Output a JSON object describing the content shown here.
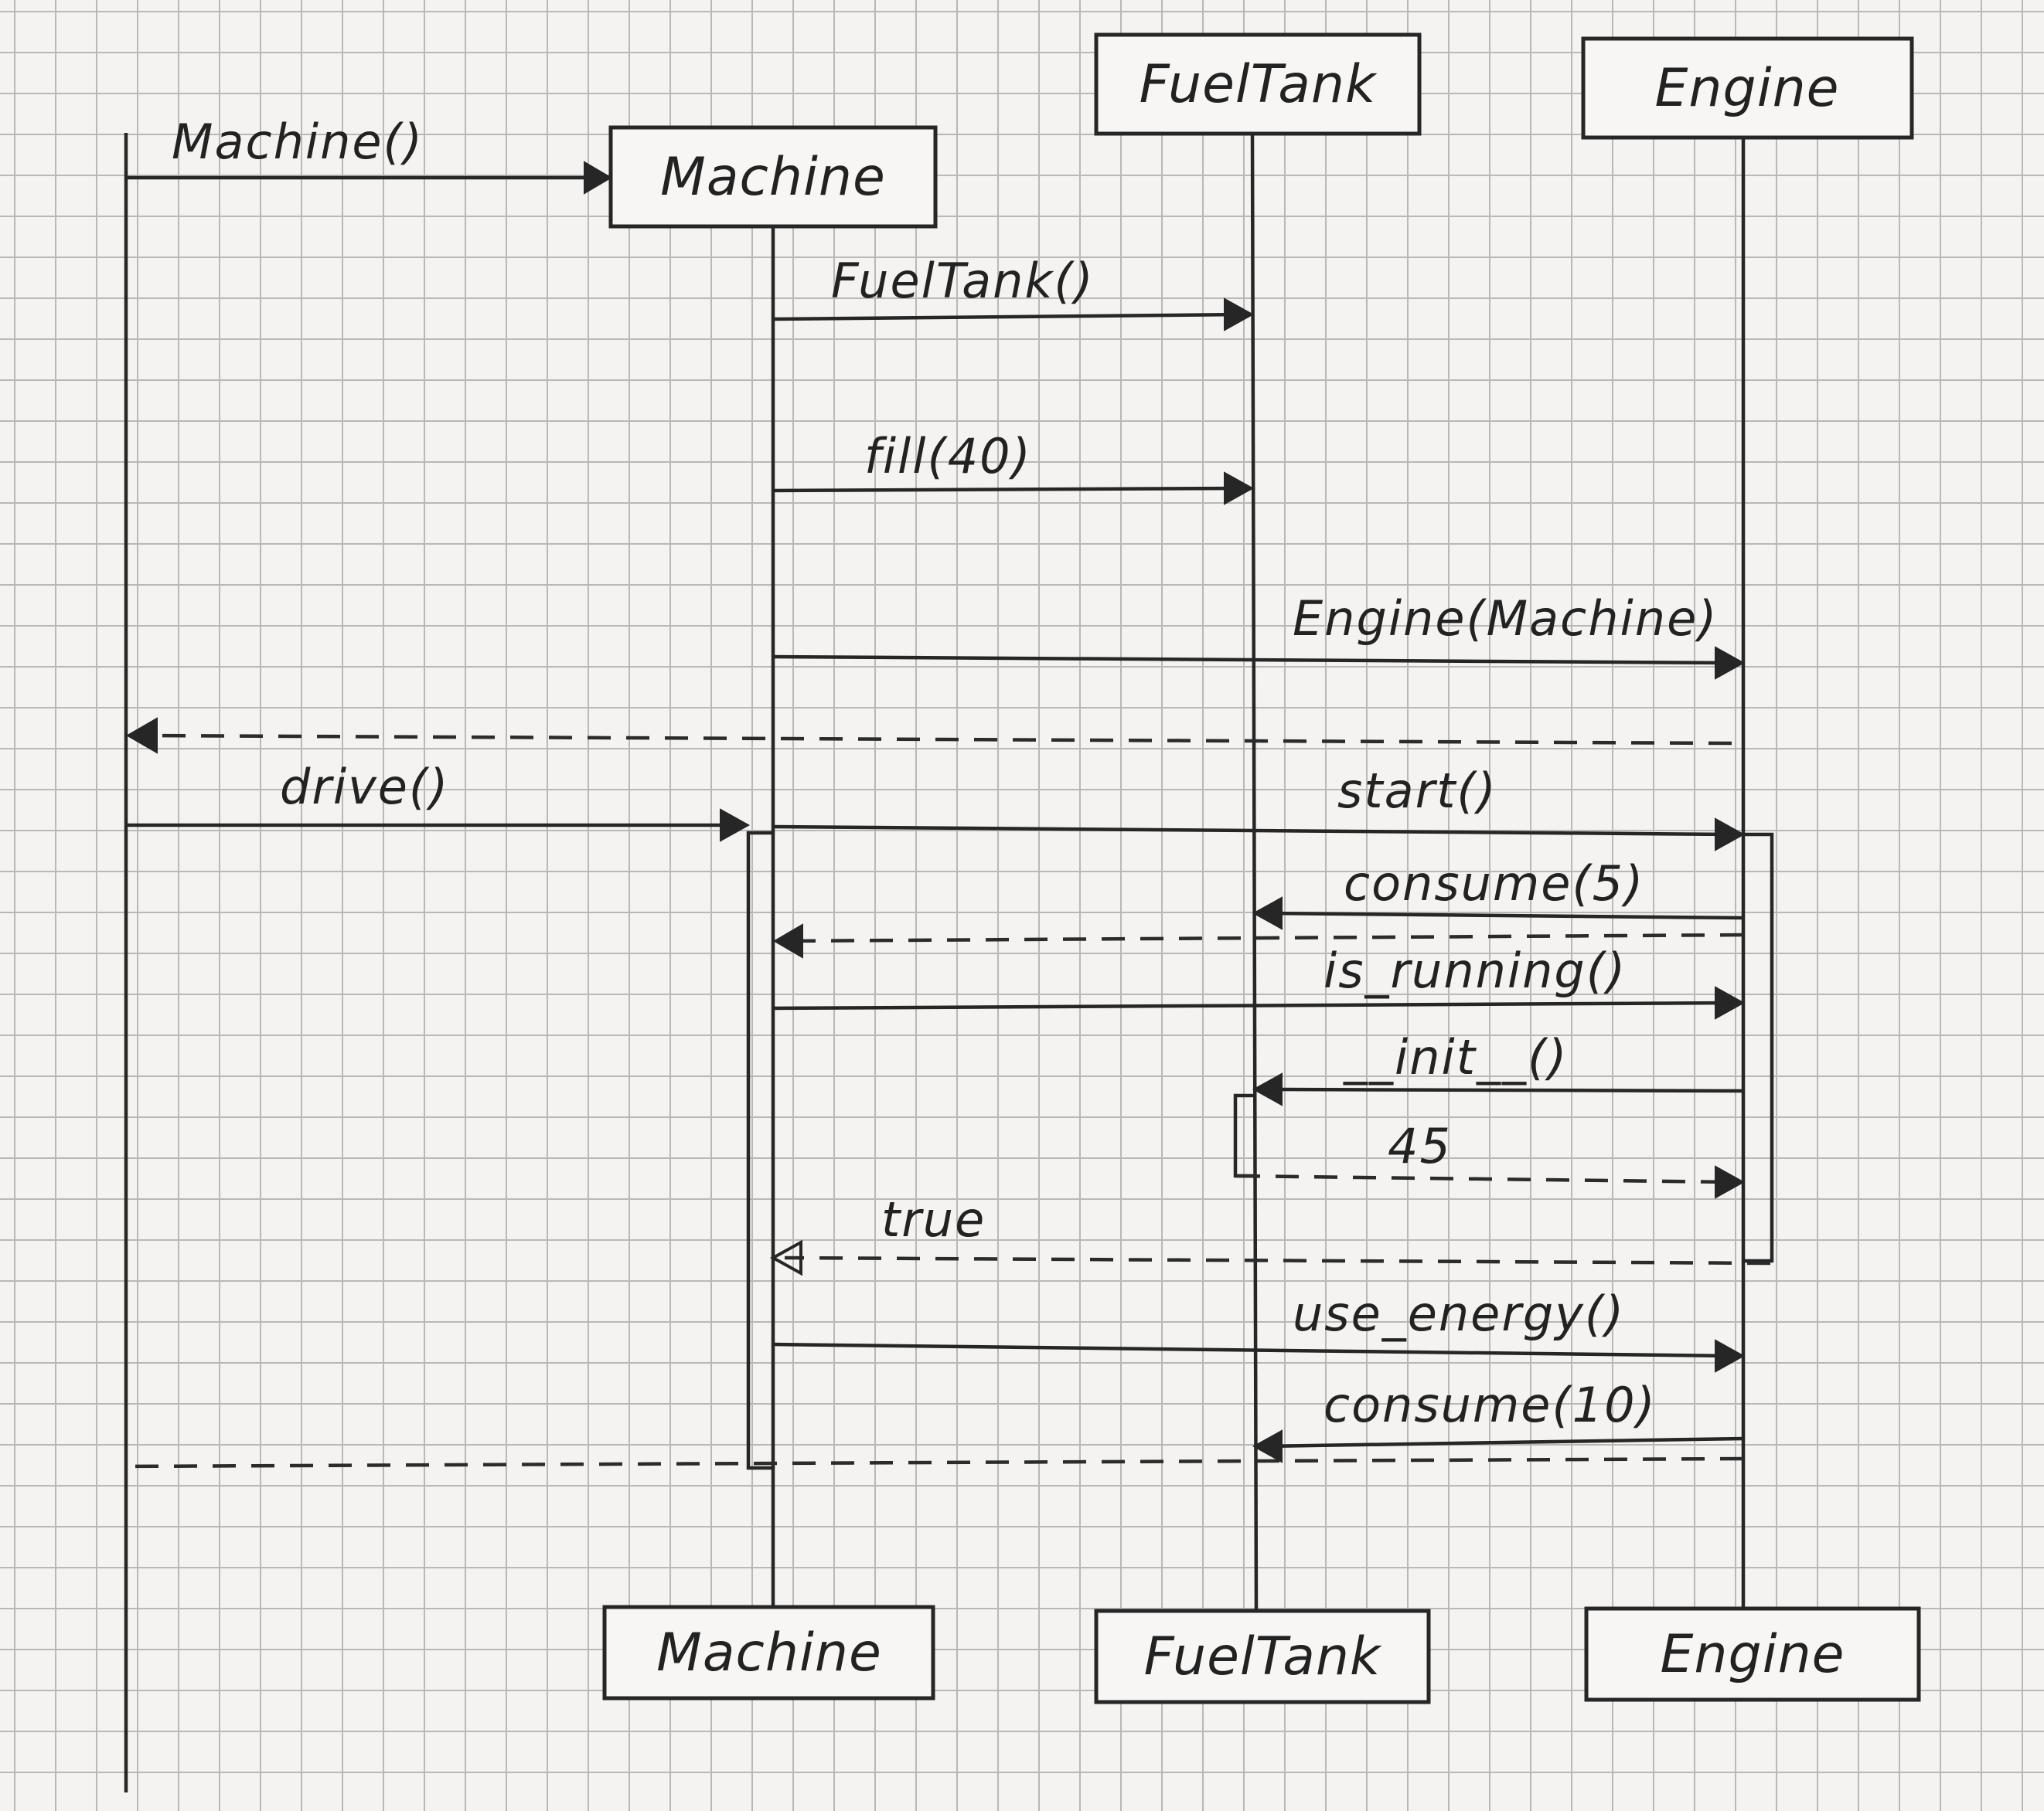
{
  "participants": {
    "machine": "Machine",
    "fueltank": "FuelTank",
    "engine": "Engine"
  },
  "messages": {
    "machine_ctor": "Machine()",
    "fueltank_ctor": "FuelTank()",
    "fill": "fill(40)",
    "engine_ctor": "Engine(Machine)",
    "drive": "drive()",
    "start": "start()",
    "consume_5": "consume(5)",
    "is_running": "is_running()",
    "init": "__init__()",
    "value_45": "45",
    "true_return": "true",
    "use_energy": "use_energy()",
    "consume_10": "consume(10)"
  }
}
